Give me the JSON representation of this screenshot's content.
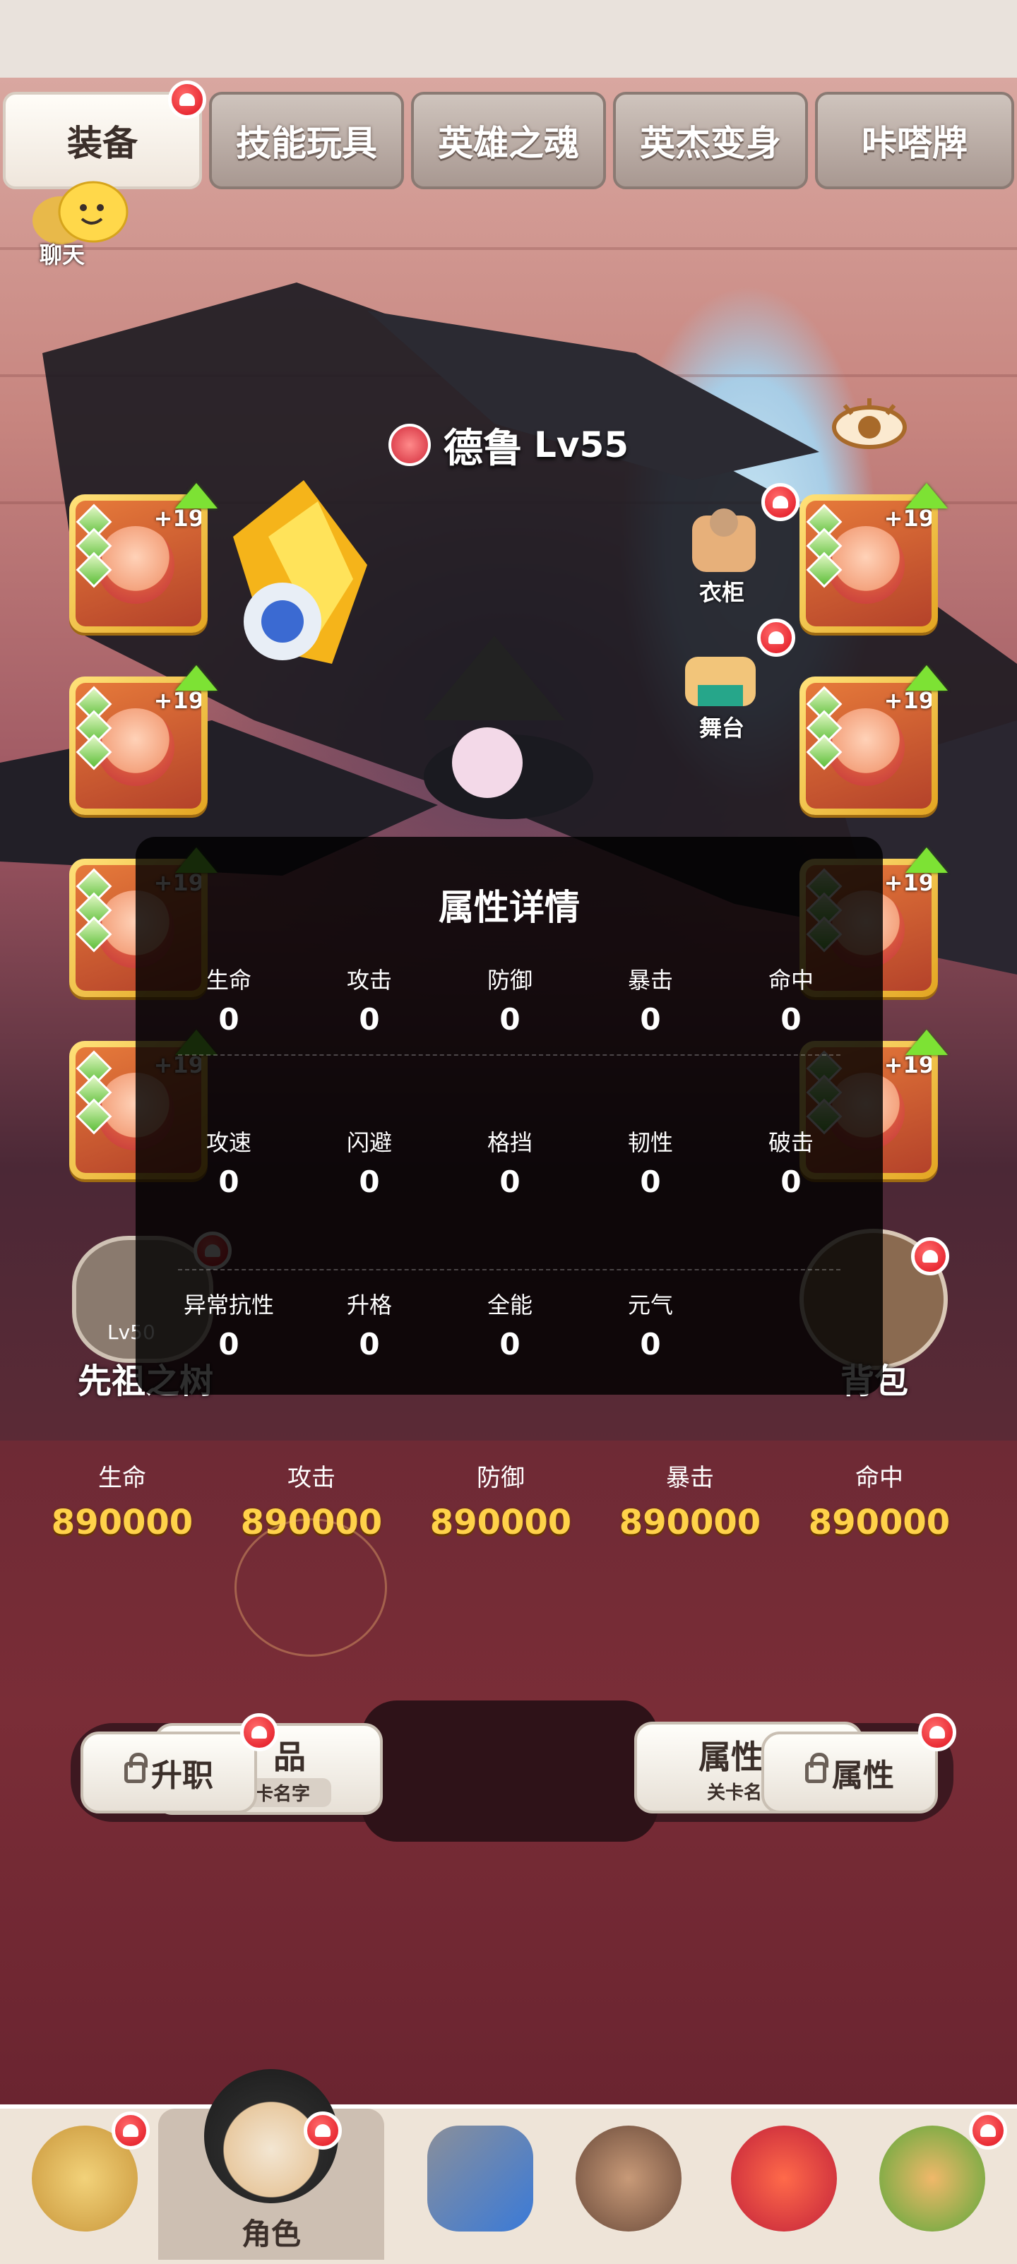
{
  "tabs": [
    {
      "label": "装备",
      "active": true
    },
    {
      "label": "技能玩具",
      "active": false
    },
    {
      "label": "英雄之魂",
      "active": false
    },
    {
      "label": "英杰变身",
      "active": false
    },
    {
      "label": "咔嗒牌",
      "active": false
    }
  ],
  "chat": {
    "label": "聊天"
  },
  "hero": {
    "name": "德鲁",
    "level": "Lv55"
  },
  "side_buttons": {
    "wardrobe": "衣柜",
    "stage": "舞台"
  },
  "equipment": {
    "level_badge": "+19"
  },
  "ancestor_tree": {
    "label": "先祖之树",
    "lock_level": "Lv50"
  },
  "backpack": {
    "label": "背包"
  },
  "attr_panel": {
    "title": "属性详情",
    "rows": [
      [
        {
          "label": "生命",
          "value": "0"
        },
        {
          "label": "攻击",
          "value": "0"
        },
        {
          "label": "防御",
          "value": "0"
        },
        {
          "label": "暴击",
          "value": "0"
        },
        {
          "label": "命中",
          "value": "0"
        }
      ],
      [
        {
          "label": "攻速",
          "value": "0"
        },
        {
          "label": "闪避",
          "value": "0"
        },
        {
          "label": "格挡",
          "value": "0"
        },
        {
          "label": "韧性",
          "value": "0"
        },
        {
          "label": "破击",
          "value": "0"
        }
      ],
      [
        {
          "label": "异常抗性",
          "value": "0"
        },
        {
          "label": "升格",
          "value": "0"
        },
        {
          "label": "全能",
          "value": "0"
        },
        {
          "label": "元气",
          "value": "0"
        }
      ]
    ]
  },
  "stats": [
    {
      "label": "生命",
      "value": "890000"
    },
    {
      "label": "攻击",
      "value": "890000"
    },
    {
      "label": "防御",
      "value": "890000"
    },
    {
      "label": "暴击",
      "value": "890000"
    },
    {
      "label": "命中",
      "value": "890000"
    }
  ],
  "buttons": {
    "promote": "升职",
    "card_left_top": "品",
    "card_left_sub": "卡名字",
    "card_right_top": "属性",
    "card_right_sub": "关卡名",
    "attribute": "属性"
  },
  "bottom_nav": {
    "active_label": "角色"
  },
  "colors": {
    "accent_gold": "#ffd24a",
    "badge_red": "#e0121f",
    "panel_bg": "#000000"
  }
}
